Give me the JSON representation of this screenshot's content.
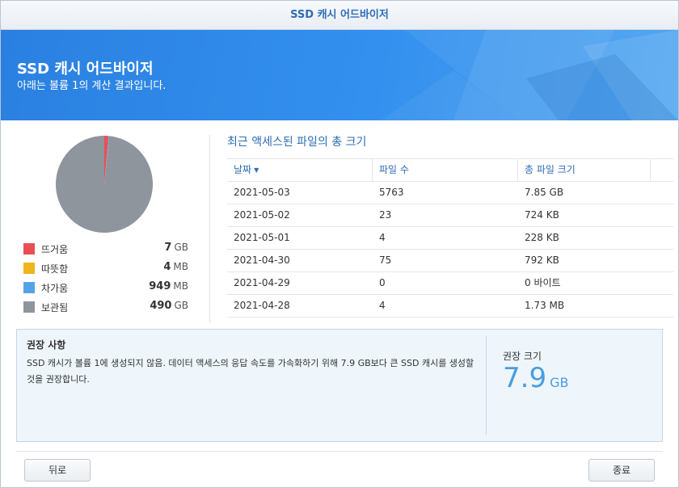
{
  "window": {
    "title": "SSD 캐시 어드바이저"
  },
  "banner": {
    "title": "SSD 캐시 어드바이저",
    "subtitle": "아래는 볼륨 1의 계산 결과입니다."
  },
  "colors": {
    "hot": "#e84f55",
    "warm": "#f0b51c",
    "cold": "#54a3e8",
    "retained": "#8e959d",
    "accent": "#2e6db4"
  },
  "legend": [
    {
      "label": "뜨거움",
      "value": "7",
      "unit": "GB",
      "color": "#e84f55"
    },
    {
      "label": "따뜻함",
      "value": "4",
      "unit": "MB",
      "color": "#f0b51c"
    },
    {
      "label": "차가움",
      "value": "949",
      "unit": "MB",
      "color": "#54a3e8"
    },
    {
      "label": "보관됨",
      "value": "490",
      "unit": "GB",
      "color": "#8e959d"
    }
  ],
  "chart_data": {
    "type": "pie",
    "categories": [
      "뜨거움",
      "따뜻함",
      "차가움",
      "보관됨"
    ],
    "values": [
      7,
      0.004,
      0.949,
      490
    ],
    "colors": [
      "#e84f55",
      "#f0b51c",
      "#54a3e8",
      "#8e959d"
    ]
  },
  "files": {
    "title": "최근 액세스된 파일의 총 크기",
    "headers": {
      "date": "날짜",
      "count": "파일 수",
      "size": "총 파일 크기"
    },
    "rows": [
      {
        "date": "2021-05-03",
        "count": "5763",
        "size": "7.85 GB"
      },
      {
        "date": "2021-05-02",
        "count": "23",
        "size": "724 KB"
      },
      {
        "date": "2021-05-01",
        "count": "4",
        "size": "228 KB"
      },
      {
        "date": "2021-04-30",
        "count": "75",
        "size": "792 KB"
      },
      {
        "date": "2021-04-29",
        "count": "0",
        "size": "0 바이트"
      },
      {
        "date": "2021-04-28",
        "count": "4",
        "size": "1.73 MB"
      }
    ]
  },
  "recommendation": {
    "title": "권장 사항",
    "text": "SSD 캐시가 볼륨 1에 생성되지 않음. 데이터 액세스의 응답 속도를 가속화하기 위해 7.9 GB보다 큰 SSD 캐시를 생성할 것을 권장합니다.",
    "size_label": "권장 크기",
    "size_value": "7.9",
    "size_unit": "GB"
  },
  "buttons": {
    "back": "뒤로",
    "close": "종료"
  }
}
